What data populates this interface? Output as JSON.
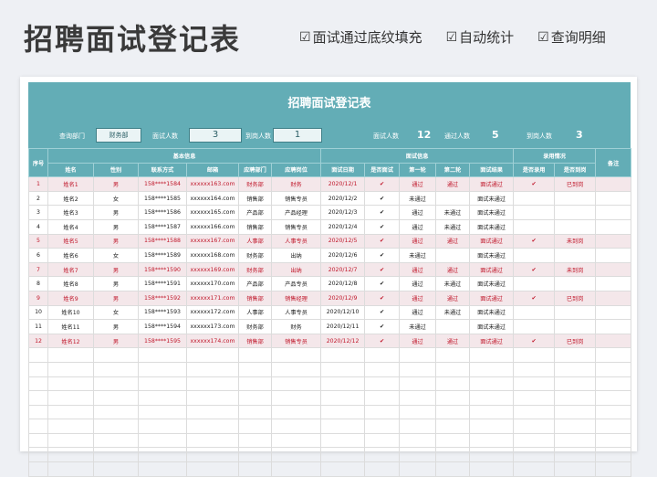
{
  "header": {
    "title": "招聘面试登记表",
    "features": [
      {
        "icon": "checkbox-icon",
        "label": "面试通过底纹填充"
      },
      {
        "icon": "checkbox-icon",
        "label": "自动统计"
      },
      {
        "icon": "checkbox-icon",
        "label": "查询明细"
      }
    ]
  },
  "sheet": {
    "title": "招聘面试登记表",
    "filters": {
      "dept_label": "查询部门",
      "dept_value": "财务部",
      "interview_label": "面试人数",
      "interview_value": "3",
      "arrive_label": "到岗人数",
      "arrive_value": "1"
    },
    "stats": {
      "interview_label": "面试人数",
      "interview_value": "12",
      "pass_label": "通过人数",
      "pass_value": "5",
      "arrive_label": "到岗人数",
      "arrive_value": "3"
    },
    "groups": {
      "basic": "基本信息",
      "interview": "面试信息",
      "hire": "录用情况",
      "remark": "备注",
      "seq": "序号"
    },
    "columns": [
      "姓名",
      "性别",
      "联系方式",
      "邮箱",
      "应聘部门",
      "应聘岗位",
      "面试日期",
      "是否面试",
      "第一轮",
      "第二轮",
      "面试结果",
      "是否录用",
      "是否到岗"
    ],
    "rows": [
      {
        "hl": true,
        "seq": "1",
        "name": "姓名1",
        "sex": "男",
        "phone": "158****1584",
        "email": "xxxxxx163.com",
        "dept": "财务部",
        "pos": "财务",
        "date": "2020/12/1",
        "interviewed": "✔",
        "r1": "通过",
        "r2": "通过",
        "result": "面试通过",
        "hired": "✔",
        "arrived": "已到岗"
      },
      {
        "hl": false,
        "seq": "2",
        "name": "姓名2",
        "sex": "女",
        "phone": "158****1585",
        "email": "xxxxxx164.com",
        "dept": "销售部",
        "pos": "销售专员",
        "date": "2020/12/2",
        "interviewed": "✔",
        "r1": "未通过",
        "r2": "",
        "result": "面试未通过",
        "hired": "",
        "arrived": ""
      },
      {
        "hl": false,
        "seq": "3",
        "name": "姓名3",
        "sex": "男",
        "phone": "158****1586",
        "email": "xxxxxx165.com",
        "dept": "产品部",
        "pos": "产品经理",
        "date": "2020/12/3",
        "interviewed": "✔",
        "r1": "通过",
        "r2": "未通过",
        "result": "面试未通过",
        "hired": "",
        "arrived": ""
      },
      {
        "hl": false,
        "seq": "4",
        "name": "姓名4",
        "sex": "男",
        "phone": "158****1587",
        "email": "xxxxxx166.com",
        "dept": "销售部",
        "pos": "销售专员",
        "date": "2020/12/4",
        "interviewed": "✔",
        "r1": "通过",
        "r2": "未通过",
        "result": "面试未通过",
        "hired": "",
        "arrived": ""
      },
      {
        "hl": true,
        "seq": "5",
        "name": "姓名5",
        "sex": "男",
        "phone": "158****1588",
        "email": "xxxxxx167.com",
        "dept": "人事部",
        "pos": "人事专员",
        "date": "2020/12/5",
        "interviewed": "✔",
        "r1": "通过",
        "r2": "通过",
        "result": "面试通过",
        "hired": "✔",
        "arrived": "未到岗"
      },
      {
        "hl": false,
        "seq": "6",
        "name": "姓名6",
        "sex": "女",
        "phone": "158****1589",
        "email": "xxxxxx168.com",
        "dept": "财务部",
        "pos": "出纳",
        "date": "2020/12/6",
        "interviewed": "✔",
        "r1": "未通过",
        "r2": "",
        "result": "面试未通过",
        "hired": "",
        "arrived": ""
      },
      {
        "hl": true,
        "seq": "7",
        "name": "姓名7",
        "sex": "男",
        "phone": "158****1590",
        "email": "xxxxxx169.com",
        "dept": "财务部",
        "pos": "出纳",
        "date": "2020/12/7",
        "interviewed": "✔",
        "r1": "通过",
        "r2": "通过",
        "result": "面试通过",
        "hired": "✔",
        "arrived": "未到岗"
      },
      {
        "hl": false,
        "seq": "8",
        "name": "姓名8",
        "sex": "男",
        "phone": "158****1591",
        "email": "xxxxxx170.com",
        "dept": "产品部",
        "pos": "产品专员",
        "date": "2020/12/8",
        "interviewed": "✔",
        "r1": "通过",
        "r2": "未通过",
        "result": "面试未通过",
        "hired": "",
        "arrived": ""
      },
      {
        "hl": true,
        "seq": "9",
        "name": "姓名9",
        "sex": "男",
        "phone": "158****1592",
        "email": "xxxxxx171.com",
        "dept": "销售部",
        "pos": "销售经理",
        "date": "2020/12/9",
        "interviewed": "✔",
        "r1": "通过",
        "r2": "通过",
        "result": "面试通过",
        "hired": "✔",
        "arrived": "已到岗"
      },
      {
        "hl": false,
        "seq": "10",
        "name": "姓名10",
        "sex": "女",
        "phone": "158****1593",
        "email": "xxxxxx172.com",
        "dept": "人事部",
        "pos": "人事专员",
        "date": "2020/12/10",
        "interviewed": "✔",
        "r1": "通过",
        "r2": "未通过",
        "result": "面试未通过",
        "hired": "",
        "arrived": ""
      },
      {
        "hl": false,
        "seq": "11",
        "name": "姓名11",
        "sex": "男",
        "phone": "158****1594",
        "email": "xxxxxx173.com",
        "dept": "财务部",
        "pos": "财务",
        "date": "2020/12/11",
        "interviewed": "✔",
        "r1": "未通过",
        "r2": "",
        "result": "面试未通过",
        "hired": "",
        "arrived": ""
      },
      {
        "hl": true,
        "seq": "12",
        "name": "姓名12",
        "sex": "男",
        "phone": "158****1595",
        "email": "xxxxxx174.com",
        "dept": "销售部",
        "pos": "销售专员",
        "date": "2020/12/12",
        "interviewed": "✔",
        "r1": "通过",
        "r2": "通过",
        "result": "面试通过",
        "hired": "✔",
        "arrived": "已到岗"
      }
    ],
    "empty_rows": 9
  }
}
